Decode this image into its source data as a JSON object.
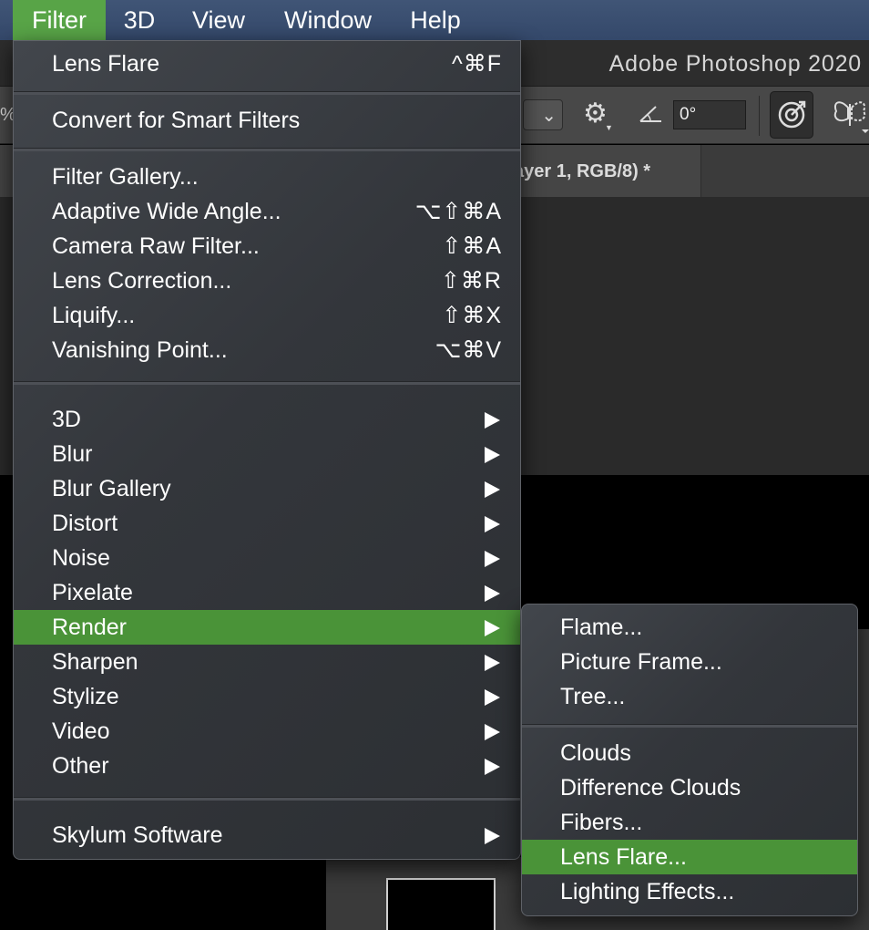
{
  "menubar": {
    "items": [
      {
        "label": "Filter",
        "active": true
      },
      {
        "label": "3D"
      },
      {
        "label": "View"
      },
      {
        "label": "Window"
      },
      {
        "label": "Help"
      }
    ]
  },
  "app": {
    "title": "Adobe Photoshop 2020",
    "zoom_fragment": "%",
    "angle_value": "0°",
    "doc_tab_label": "ayer 1, RGB/8) *"
  },
  "filter_menu": {
    "last_filter": {
      "label": "Lens Flare",
      "shortcut": "^⌘F"
    },
    "convert": {
      "label": "Convert for Smart Filters"
    },
    "group1": [
      {
        "label": "Filter Gallery...",
        "shortcut": ""
      },
      {
        "label": "Adaptive Wide Angle...",
        "shortcut": "⌥⇧⌘A"
      },
      {
        "label": "Camera Raw Filter...",
        "shortcut": "⇧⌘A"
      },
      {
        "label": "Lens Correction...",
        "shortcut": "⇧⌘R"
      },
      {
        "label": "Liquify...",
        "shortcut": "⇧⌘X"
      },
      {
        "label": "Vanishing Point...",
        "shortcut": "⌥⌘V"
      }
    ],
    "submenus": [
      {
        "label": "3D"
      },
      {
        "label": "Blur"
      },
      {
        "label": "Blur Gallery"
      },
      {
        "label": "Distort"
      },
      {
        "label": "Noise"
      },
      {
        "label": "Pixelate"
      },
      {
        "label": "Render",
        "highlighted": true
      },
      {
        "label": "Sharpen"
      },
      {
        "label": "Stylize"
      },
      {
        "label": "Video"
      },
      {
        "label": "Other"
      }
    ],
    "plugins": [
      {
        "label": "Skylum Software"
      }
    ]
  },
  "render_submenu": {
    "group1": [
      {
        "label": "Flame..."
      },
      {
        "label": "Picture Frame..."
      },
      {
        "label": "Tree..."
      }
    ],
    "group2": [
      {
        "label": "Clouds"
      },
      {
        "label": "Difference Clouds"
      },
      {
        "label": "Fibers..."
      },
      {
        "label": "Lens Flare...",
        "highlighted": true
      },
      {
        "label": "Lighting Effects..."
      }
    ]
  },
  "colors": {
    "menubar_bg": "#3b4f72",
    "menubar_active": "#58a447",
    "menu_highlight": "#4a9338",
    "menu_bg": "#34373c"
  }
}
